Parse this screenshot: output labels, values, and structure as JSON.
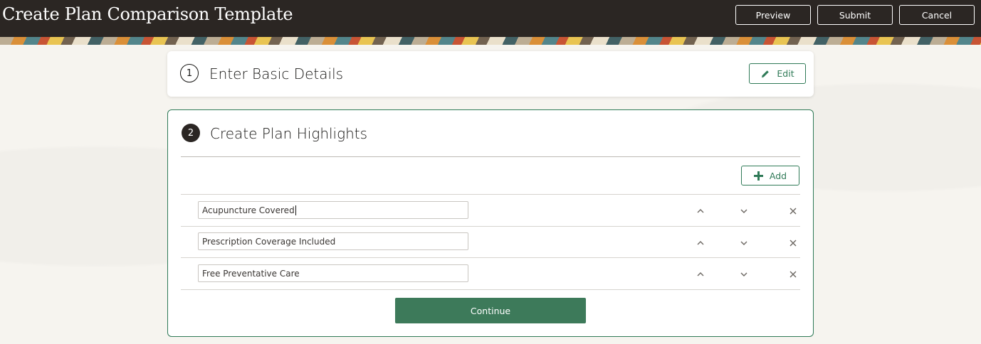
{
  "header": {
    "title": "Create Plan Comparison Template",
    "buttons": {
      "preview": "Preview",
      "submit": "Submit",
      "cancel": "Cancel"
    }
  },
  "step1": {
    "number": "1",
    "title": "Enter Basic Details",
    "edit_label": "Edit",
    "edit_icon": "pencil-icon"
  },
  "step2": {
    "number": "2",
    "title": "Create Plan Highlights",
    "add_label": "Add",
    "add_icon": "plus-icon",
    "highlights": [
      {
        "value": "Acupuncture Covered"
      },
      {
        "value": "Prescription Coverage Included"
      },
      {
        "value": "Free Preventative Care"
      }
    ],
    "row_icons": [
      "chevron-up-icon",
      "chevron-down-icon",
      "close-icon"
    ],
    "continue_label": "Continue"
  },
  "colors": {
    "header_bg": "#2b2623",
    "accent_green": "#2f7a57",
    "continue_green": "#3d7a5a"
  }
}
